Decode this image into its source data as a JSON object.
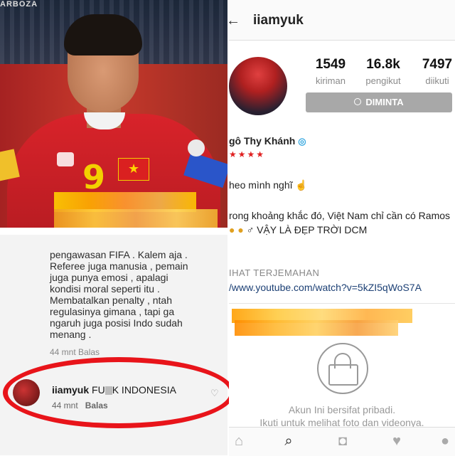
{
  "photo": {
    "corner_text": "ARBOZA",
    "jersey_number": "9",
    "flag_star": "★"
  },
  "comment": {
    "body_lines": [
      "pengawasan FIFA . Kalem aja .",
      "Referee juga manusia , pemain",
      "juga punya emosi , apalagi",
      "kondisi moral seperti itu .",
      "Membatalkan penalty , ntah",
      "regulasinya gimana , tapi ga",
      "ngaruh juga posisi Indo sudah",
      "menang ."
    ],
    "prev_meta": "44 mnt   Balas",
    "username": "iiamyuk",
    "text": "FU",
    "text_rest": "K INDONESIA",
    "time": "44 mnt",
    "reply": "Balas",
    "heart_icon": "♡"
  },
  "profile": {
    "back_icon": "←",
    "username": "iiamyuk",
    "stats": [
      {
        "num": "1549",
        "label": "kiriman"
      },
      {
        "num": "16.8k",
        "label": "pengikut"
      },
      {
        "num": "7497",
        "label": "diikuti"
      }
    ],
    "button_label": "DIMINTA",
    "display_name": "gô Thy Khánh",
    "flags": "★★★★",
    "bio_line1": "heo mình nghĩ ☝",
    "bio_line2": "rong khoảng khắc đó, Việt Nam chỉ cần có Ramos",
    "bio_line3": "♂ VẬY LÀ ĐẸP TRỜI DCM",
    "translate": "IHAT TERJEMAHAN",
    "link": "/www.youtube.com/watch?v=5kZI5qWoS7A",
    "private_line1": "Akun Ini bersifat pribadi.",
    "private_line2": "Ikuti untuk melihat foto dan videonya.",
    "nav_icons": [
      "home-icon",
      "search-icon",
      "camera-icon",
      "heart-icon",
      "profile-icon"
    ]
  }
}
